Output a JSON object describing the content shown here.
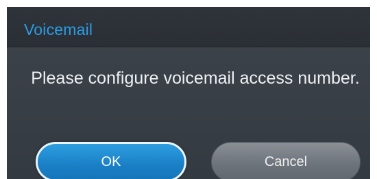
{
  "dialog": {
    "title": "Voicemail",
    "message": "Please configure voicemail access number.",
    "buttons": {
      "ok_label": "OK",
      "cancel_label": "Cancel"
    }
  },
  "colors": {
    "title_accent": "#2b9ce6",
    "ok_button": "#1a7fc6",
    "cancel_button": "#6e747b",
    "dialog_background": "#3a4047"
  }
}
